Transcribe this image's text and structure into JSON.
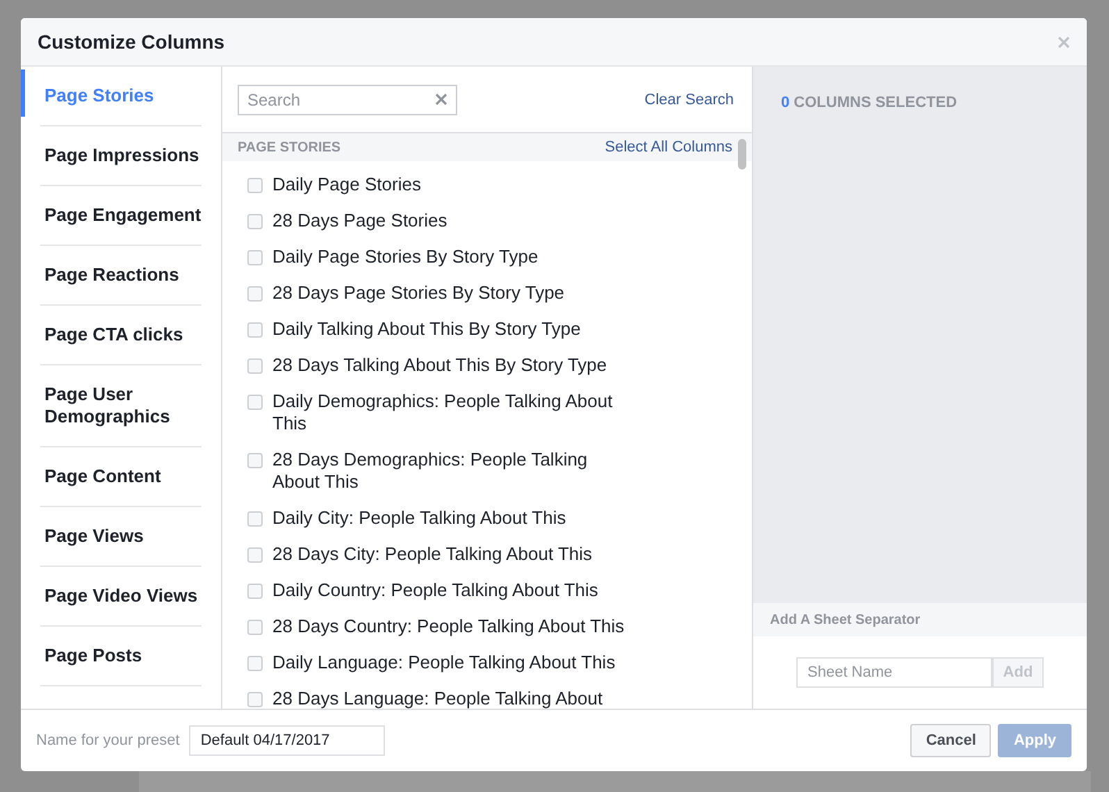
{
  "dialog": {
    "title": "Customize Columns"
  },
  "categories": [
    {
      "label": "Page Stories",
      "selected": true
    },
    {
      "label": "Page Impressions",
      "selected": false
    },
    {
      "label": "Page Engagement",
      "selected": false
    },
    {
      "label": "Page Reactions",
      "selected": false
    },
    {
      "label": "Page CTA clicks",
      "selected": false
    },
    {
      "label": "Page User Demographics",
      "selected": false
    },
    {
      "label": "Page Content",
      "selected": false
    },
    {
      "label": "Page Views",
      "selected": false
    },
    {
      "label": "Page Video Views",
      "selected": false
    },
    {
      "label": "Page Posts",
      "selected": false
    }
  ],
  "search": {
    "placeholder": "Search"
  },
  "clear_search": "Clear Search",
  "section": {
    "title": "PAGE STORIES",
    "select_all": "Select All Columns"
  },
  "columns": [
    {
      "label": "Daily Page Stories",
      "checked": false
    },
    {
      "label": "28 Days Page Stories",
      "checked": false
    },
    {
      "label": "Daily Page Stories By Story Type",
      "checked": false
    },
    {
      "label": "28 Days Page Stories By Story Type",
      "checked": false
    },
    {
      "label": "Daily Talking About This By Story Type",
      "checked": false
    },
    {
      "label": "28 Days Talking About This By Story Type",
      "checked": false
    },
    {
      "label": "Daily Demographics: People Talking About This",
      "checked": false
    },
    {
      "label": "28 Days Demographics: People Talking About This",
      "checked": false
    },
    {
      "label": "Daily City: People Talking About This",
      "checked": false
    },
    {
      "label": "28 Days City: People Talking About This",
      "checked": false
    },
    {
      "label": "Daily Country: People Talking About This",
      "checked": false
    },
    {
      "label": "28 Days Country: People Talking About This",
      "checked": false
    },
    {
      "label": "Daily Language: People Talking About This",
      "checked": false
    },
    {
      "label": "28 Days Language: People Talking About",
      "checked": false
    }
  ],
  "summary": {
    "count": "0",
    "label": "COLUMNS SELECTED"
  },
  "separator": {
    "title": "Add A Sheet Separator",
    "placeholder": "Sheet Name",
    "add_button": {
      "label": "Add",
      "disabled": true
    }
  },
  "footer": {
    "preset_label": "Name for your preset",
    "preset_value": "Default 04/17/2017",
    "buttons": [
      {
        "label": "Cancel",
        "kind": "secondary",
        "disabled": false
      },
      {
        "label": "Apply",
        "kind": "primary",
        "disabled": true
      }
    ]
  }
}
